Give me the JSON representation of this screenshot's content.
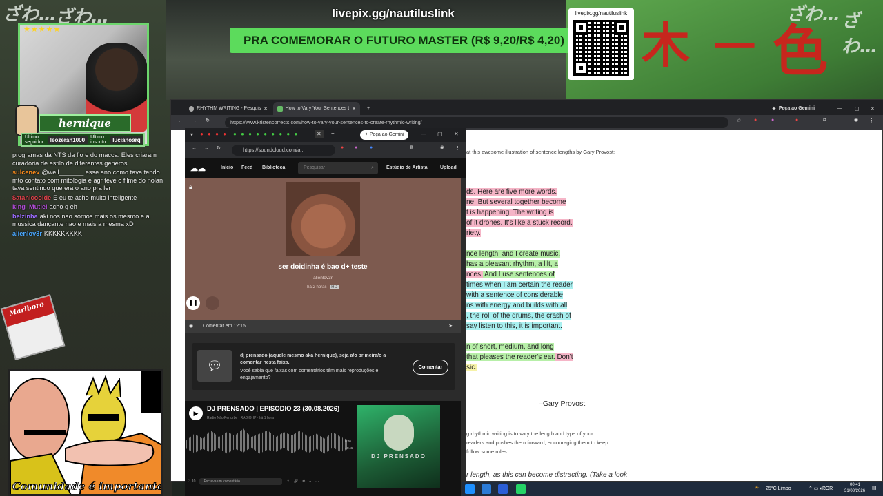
{
  "overlay": {
    "top_url": "livepix.gg/nautiluslink",
    "banner": "PRA COMEMORAR O FUTURO MASTER (R$ 9,20/R$ 4,20)",
    "qr_label": "livepix.gg/nautiluslink",
    "graffiti": [
      "ざわ…",
      "ざわ…",
      "ざわ…",
      "ざわ…"
    ]
  },
  "streamer": {
    "stars": "★★★★★",
    "name": "hernique",
    "last_follower_label": "Último seguidor:",
    "last_follower": "leozerah1000",
    "last_sub_label": "Último inscrito:",
    "last_sub": "lucianoarq"
  },
  "chat": [
    {
      "user": "",
      "color": "#cfcfcf",
      "text": "programas da NTS da flo e do macca. Eles criaram curadoria de estilo de diferentes generos"
    },
    {
      "user": "sulcenev",
      "color": "#ff8c1a",
      "text": "@well_______ esse ano como tava tendo mto contato com mitologia e agr teve o filme do nolan tava sentindo que era o ano pra ler"
    },
    {
      "user": "$atanicoolde",
      "color": "#e0404a",
      "text": "E eu te acho muito inteligente"
    },
    {
      "user": "king_Mutlel",
      "color": "#b04cd6",
      "text": "acho q eh"
    },
    {
      "user": "belzinha",
      "color": "#9b6bff",
      "text": "aki nos nao somos mais os mesmo e a mussica dançante nao e mais a mesma xD"
    },
    {
      "user": "alienlov3r",
      "color": "#4aa8ff",
      "text": "KKKKKKKKK"
    }
  ],
  "cigarette_brand": "Marlboro",
  "cartoon_caption": "Comunidade é importante",
  "browser": {
    "tabs": [
      "RHYTHM WRITING - Pesquisa G",
      "How to Vary Your Sentences to"
    ],
    "gemini": "Peça ao Gemini",
    "url": "https://www.kristencorrects.com/how-to-vary-your-sentences-to-create-rhythmic-writing/"
  },
  "article": {
    "intro": "at this awesome illustration of sentence lengths by Gary Provost:",
    "lines": [
      {
        "text": "ds. Here are five more words.",
        "hl": "pink"
      },
      {
        "text": "ne. But several together become",
        "hl": "pink"
      },
      {
        "text": "t is happening. The writing is",
        "hl": "pink"
      },
      {
        "text": "of it drones. It's like a stuck record.",
        "hl": "pink"
      },
      {
        "text": "riety.",
        "hl": "pink"
      },
      {
        "text": "",
        "hl": ""
      },
      {
        "text": "nce length, and I create music.",
        "hl": "green"
      },
      {
        "text": "has a pleasant rhythm, a lilt, a",
        "hl": "green"
      },
      {
        "text": "nces.",
        "hl": "pink",
        "tail": " And I use sentences of",
        "tail_hl": "green"
      },
      {
        "text": "times when I am certain the reader",
        "hl": "cyan"
      },
      {
        "text": "with a sentence of considerable",
        "hl": "cyan"
      },
      {
        "text": "ns with energy and builds with all",
        "hl": "cyan"
      },
      {
        "text": ", the roll of the drums, the crash of",
        "hl": "cyan"
      },
      {
        "text": "say listen to this, it is important.",
        "hl": "cyan"
      },
      {
        "text": "",
        "hl": ""
      },
      {
        "text": "n of short, medium, and long",
        "hl": "green"
      },
      {
        "text": "that pleases the reader's ear.",
        "hl": "green",
        "tail": " Don't",
        "tail_hl": "pink"
      },
      {
        "text": "sic.",
        "hl": "yellow"
      }
    ],
    "author": "–Gary Provost",
    "p2": [
      "g rhythmic writing is to vary the length and type of your",
      "readers and pushes them forward, encouraging them to keep",
      "follow some rules:"
    ],
    "p3": "r length, as this can become distracting. (Take a look"
  },
  "soundcloud": {
    "gemini": "Peça ao Gemini",
    "url": "https://soundcloud.com/a...",
    "nav": [
      "Início",
      "Feed",
      "Biblioteca"
    ],
    "search_placeholder": "Pesquisar",
    "artist_studio": "Estúdio de Artista",
    "upload": "Upload",
    "track_title": "ser doidinha é bao d+ teste",
    "track_artist": "alienlov3r",
    "track_time": "há 2 horas",
    "track_badge": "HD",
    "comment_placeholder": "Comentar em 12:15",
    "promo_title": "dj prensado (aquele mesmo aka hernique), seja a/o primeira/o a comentar nesta faixa.",
    "promo_body": "Você sabia que faixas com comentários têm mais reproduções e engajamento?",
    "promo_button": "Comentar",
    "feed_title": "DJ PRENSADO | EPISODIO 23 (30.08.2026)",
    "feed_sub": "Radio Não Perturbe · RADIOHP · há 1 hora",
    "feed_dur_a": "0:00",
    "feed_dur_b": "46:46",
    "feed_likes": "10",
    "feed_comment_placeholder": "Escreva um comentário",
    "art_text": "DJ PRENSADO"
  },
  "taskbar": {
    "weather": "25°C Limpo",
    "lang": "POR",
    "time": "00:41",
    "date": "31/08/2026"
  }
}
